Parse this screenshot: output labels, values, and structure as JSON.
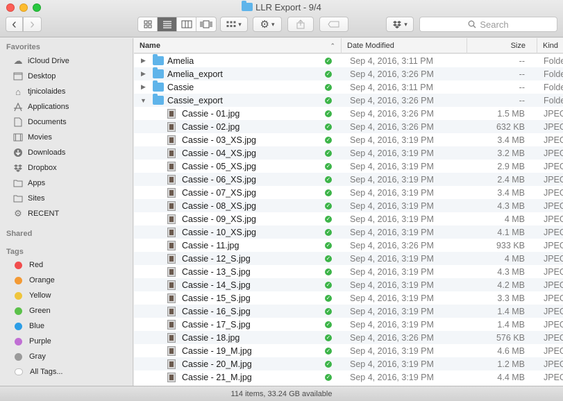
{
  "window": {
    "title": "LLR Export - 9/4"
  },
  "toolbar": {
    "back_glyph": "‹",
    "forward_glyph": "›",
    "search_placeholder": "Search"
  },
  "sidebar": {
    "favorites_header": "Favorites",
    "favorites": [
      {
        "label": "iCloud Drive",
        "icon": "cloud-icon"
      },
      {
        "label": "Desktop",
        "icon": "desktop-icon"
      },
      {
        "label": "tjnicolaides",
        "icon": "home-icon"
      },
      {
        "label": "Applications",
        "icon": "applications-icon"
      },
      {
        "label": "Documents",
        "icon": "documents-icon"
      },
      {
        "label": "Movies",
        "icon": "movies-icon"
      },
      {
        "label": "Downloads",
        "icon": "downloads-icon"
      },
      {
        "label": "Dropbox",
        "icon": "dropbox-icon"
      },
      {
        "label": "Apps",
        "icon": "folder-icon"
      },
      {
        "label": "Sites",
        "icon": "folder-icon"
      },
      {
        "label": "RECENT",
        "icon": "gear-icon"
      }
    ],
    "shared_header": "Shared",
    "tags_header": "Tags",
    "tags": [
      {
        "label": "Red",
        "color": "#f14d4d"
      },
      {
        "label": "Orange",
        "color": "#f39a35"
      },
      {
        "label": "Yellow",
        "color": "#efc53c"
      },
      {
        "label": "Green",
        "color": "#5bc14a"
      },
      {
        "label": "Blue",
        "color": "#2d9ee6"
      },
      {
        "label": "Purple",
        "color": "#c06fd4"
      },
      {
        "label": "Gray",
        "color": "#9a9a9a"
      }
    ],
    "all_tags": "All Tags..."
  },
  "columns": {
    "name": "Name",
    "date": "Date Modified",
    "size": "Size",
    "kind": "Kind"
  },
  "files": [
    {
      "name": "Amelia",
      "type": "folder",
      "expanded": false,
      "date": "Sep 4, 2016, 3:11 PM",
      "size": "--",
      "kind": "Folder"
    },
    {
      "name": "Amelia_export",
      "type": "folder",
      "expanded": false,
      "date": "Sep 4, 2016, 3:26 PM",
      "size": "--",
      "kind": "Folder"
    },
    {
      "name": "Cassie",
      "type": "folder",
      "expanded": false,
      "date": "Sep 4, 2016, 3:11 PM",
      "size": "--",
      "kind": "Folder"
    },
    {
      "name": "Cassie_export",
      "type": "folder",
      "expanded": true,
      "date": "Sep 4, 2016, 3:26 PM",
      "size": "--",
      "kind": "Folder"
    },
    {
      "name": "Cassie - 01.jpg",
      "type": "file",
      "date": "Sep 4, 2016, 3:26 PM",
      "size": "1.5 MB",
      "kind": "JPEG image"
    },
    {
      "name": "Cassie - 02.jpg",
      "type": "file",
      "date": "Sep 4, 2016, 3:26 PM",
      "size": "632 KB",
      "kind": "JPEG image"
    },
    {
      "name": "Cassie - 03_XS.jpg",
      "type": "file",
      "date": "Sep 4, 2016, 3:19 PM",
      "size": "3.4 MB",
      "kind": "JPEG image"
    },
    {
      "name": "Cassie - 04_XS.jpg",
      "type": "file",
      "date": "Sep 4, 2016, 3:19 PM",
      "size": "3.2 MB",
      "kind": "JPEG image"
    },
    {
      "name": "Cassie - 05_XS.jpg",
      "type": "file",
      "date": "Sep 4, 2016, 3:19 PM",
      "size": "2.9 MB",
      "kind": "JPEG image"
    },
    {
      "name": "Cassie - 06_XS.jpg",
      "type": "file",
      "date": "Sep 4, 2016, 3:19 PM",
      "size": "2.4 MB",
      "kind": "JPEG image"
    },
    {
      "name": "Cassie - 07_XS.jpg",
      "type": "file",
      "date": "Sep 4, 2016, 3:19 PM",
      "size": "3.4 MB",
      "kind": "JPEG image"
    },
    {
      "name": "Cassie - 08_XS.jpg",
      "type": "file",
      "date": "Sep 4, 2016, 3:19 PM",
      "size": "4.3 MB",
      "kind": "JPEG image"
    },
    {
      "name": "Cassie - 09_XS.jpg",
      "type": "file",
      "date": "Sep 4, 2016, 3:19 PM",
      "size": "4 MB",
      "kind": "JPEG image"
    },
    {
      "name": "Cassie - 10_XS.jpg",
      "type": "file",
      "date": "Sep 4, 2016, 3:19 PM",
      "size": "4.1 MB",
      "kind": "JPEG image"
    },
    {
      "name": "Cassie - 11.jpg",
      "type": "file",
      "date": "Sep 4, 2016, 3:26 PM",
      "size": "933 KB",
      "kind": "JPEG image"
    },
    {
      "name": "Cassie - 12_S.jpg",
      "type": "file",
      "date": "Sep 4, 2016, 3:19 PM",
      "size": "4 MB",
      "kind": "JPEG image"
    },
    {
      "name": "Cassie - 13_S.jpg",
      "type": "file",
      "date": "Sep 4, 2016, 3:19 PM",
      "size": "4.3 MB",
      "kind": "JPEG image"
    },
    {
      "name": "Cassie - 14_S.jpg",
      "type": "file",
      "date": "Sep 4, 2016, 3:19 PM",
      "size": "4.2 MB",
      "kind": "JPEG image"
    },
    {
      "name": "Cassie - 15_S.jpg",
      "type": "file",
      "date": "Sep 4, 2016, 3:19 PM",
      "size": "3.3 MB",
      "kind": "JPEG image"
    },
    {
      "name": "Cassie - 16_S.jpg",
      "type": "file",
      "date": "Sep 4, 2016, 3:19 PM",
      "size": "1.4 MB",
      "kind": "JPEG image"
    },
    {
      "name": "Cassie - 17_S.jpg",
      "type": "file",
      "date": "Sep 4, 2016, 3:19 PM",
      "size": "1.4 MB",
      "kind": "JPEG image"
    },
    {
      "name": "Cassie - 18.jpg",
      "type": "file",
      "date": "Sep 4, 2016, 3:26 PM",
      "size": "576 KB",
      "kind": "JPEG image"
    },
    {
      "name": "Cassie - 19_M.jpg",
      "type": "file",
      "date": "Sep 4, 2016, 3:19 PM",
      "size": "4.6 MB",
      "kind": "JPEG image"
    },
    {
      "name": "Cassie - 20_M.jpg",
      "type": "file",
      "date": "Sep 4, 2016, 3:19 PM",
      "size": "1.2 MB",
      "kind": "JPEG image"
    },
    {
      "name": "Cassie - 21_M.jpg",
      "type": "file",
      "date": "Sep 4, 2016, 3:19 PM",
      "size": "4.4 MB",
      "kind": "JPEG image"
    }
  ],
  "status": {
    "text": "114 items, 33.24 GB available"
  }
}
